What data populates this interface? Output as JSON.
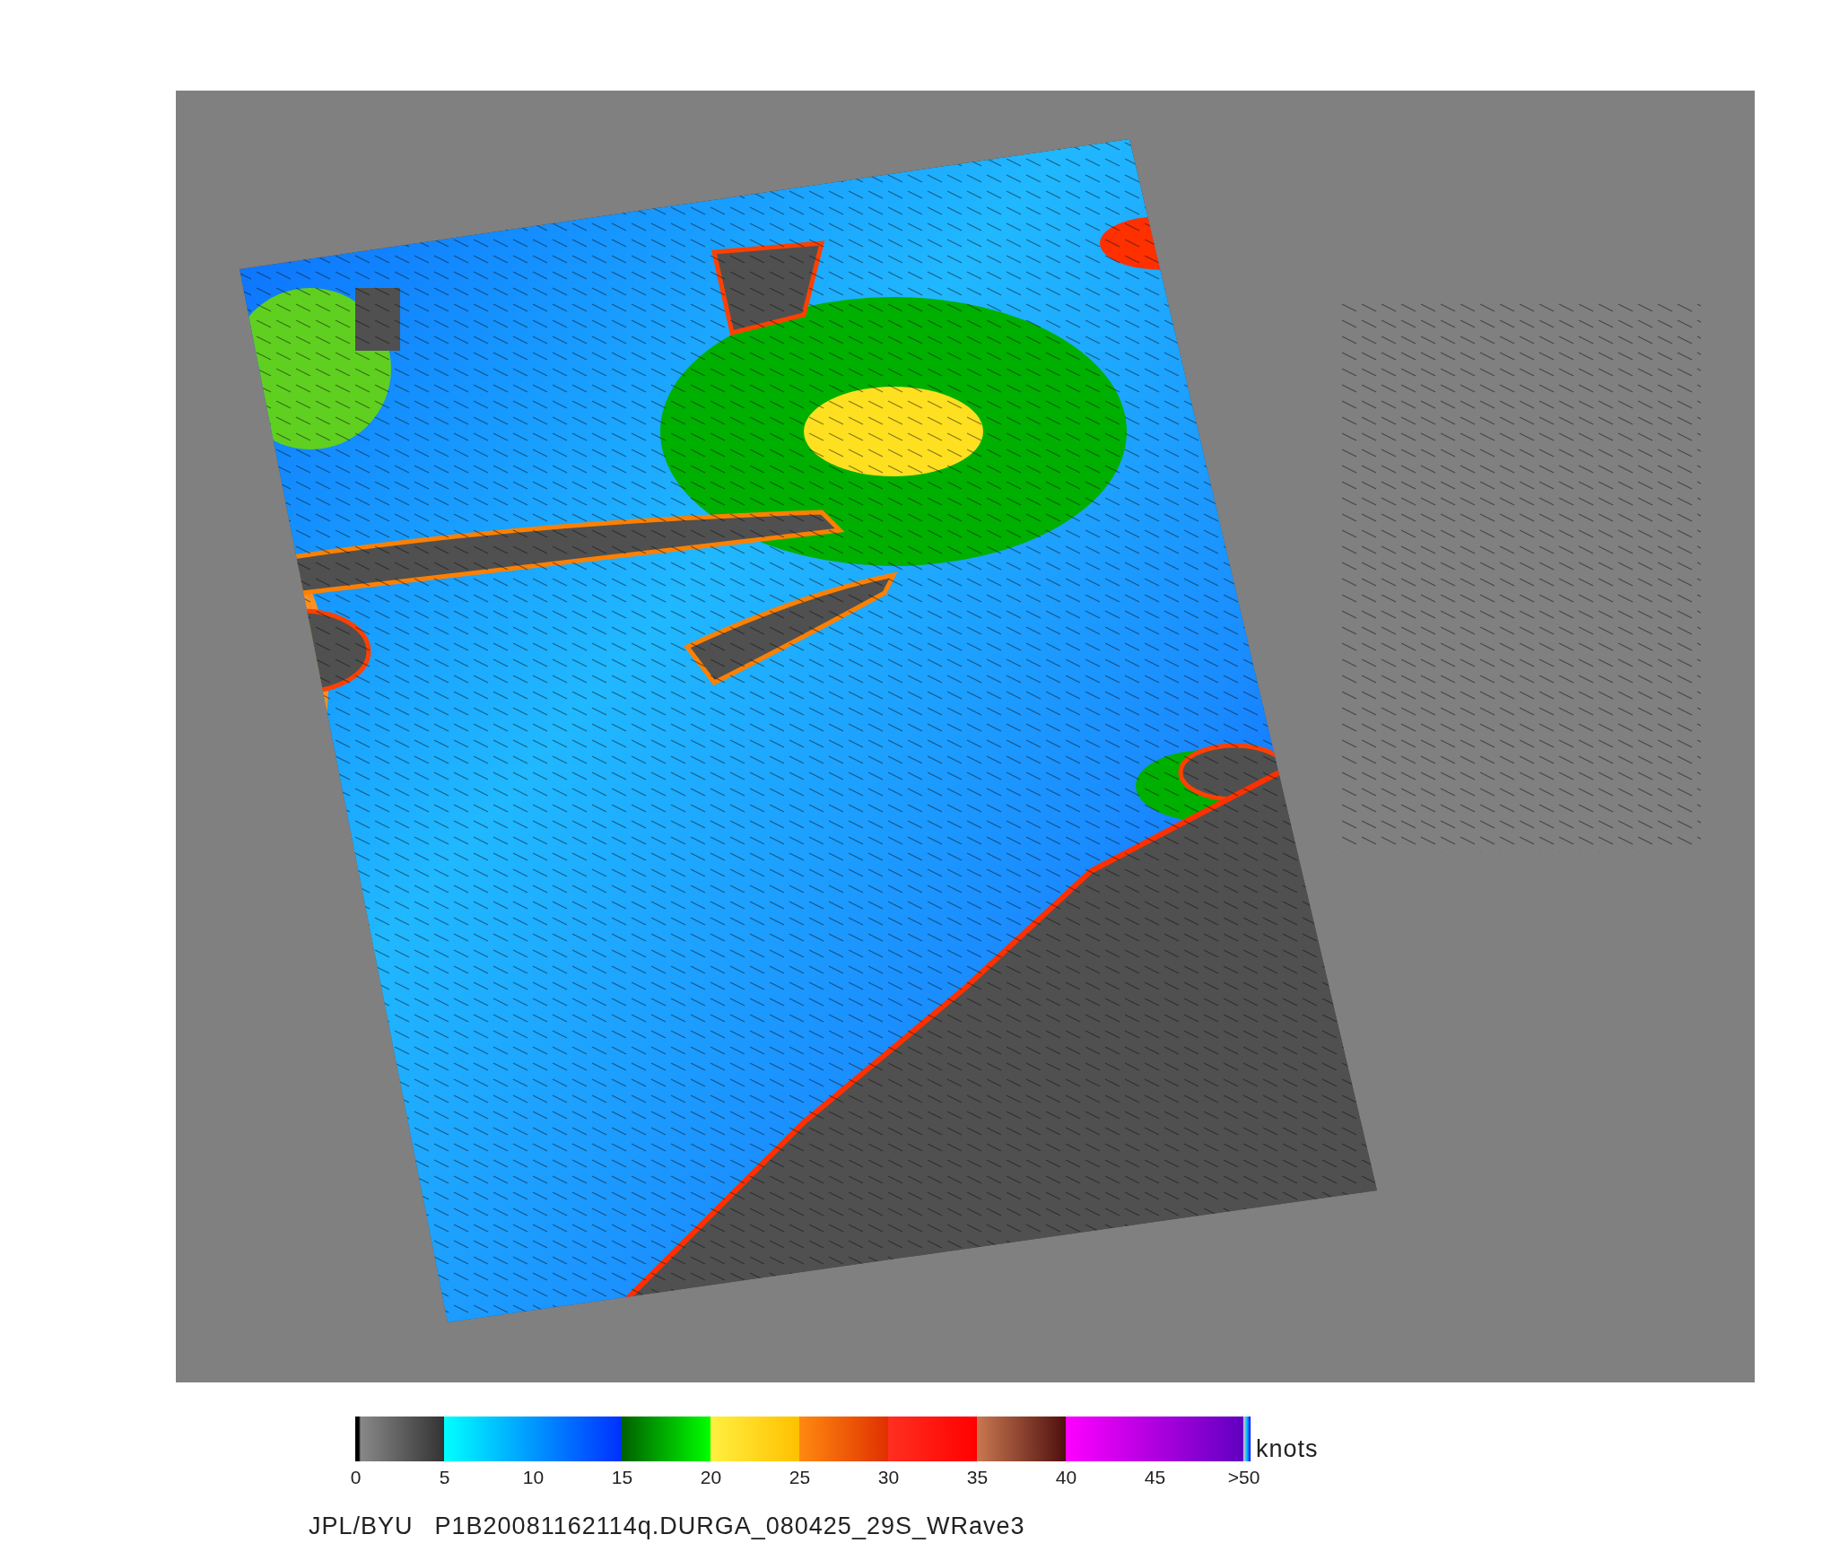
{
  "colorbar": {
    "ticks": [
      "0",
      "5",
      "10",
      "15",
      "20",
      "25",
      "30",
      "35",
      "40",
      "45",
      ">50"
    ],
    "unit": "knots"
  },
  "footer": {
    "source": "JPL/BYU",
    "product": "P1B20081162114q.DURGA_080425_29S_WRave3"
  }
}
